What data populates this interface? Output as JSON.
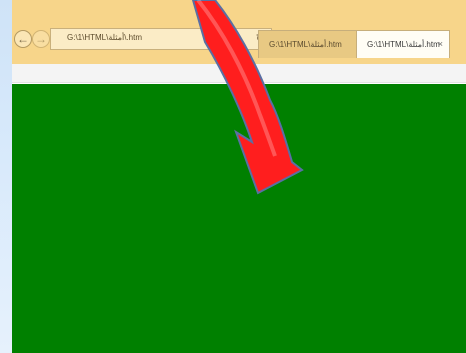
{
  "browser": {
    "address_url": "G:\\1\\HTML\\أمثلة\\.htm",
    "tabs": [
      {
        "label": "G:\\1\\HTML\\أمثلة.htm",
        "active": false
      },
      {
        "label": "G:\\1\\HTML\\أمثلة.htm",
        "active": true,
        "close": "×"
      }
    ]
  },
  "page": {
    "background_color": "#008000"
  },
  "overlay": {
    "arrow_color": "#ff0000",
    "arrow_icon": "curved-arrow-down-icon"
  }
}
